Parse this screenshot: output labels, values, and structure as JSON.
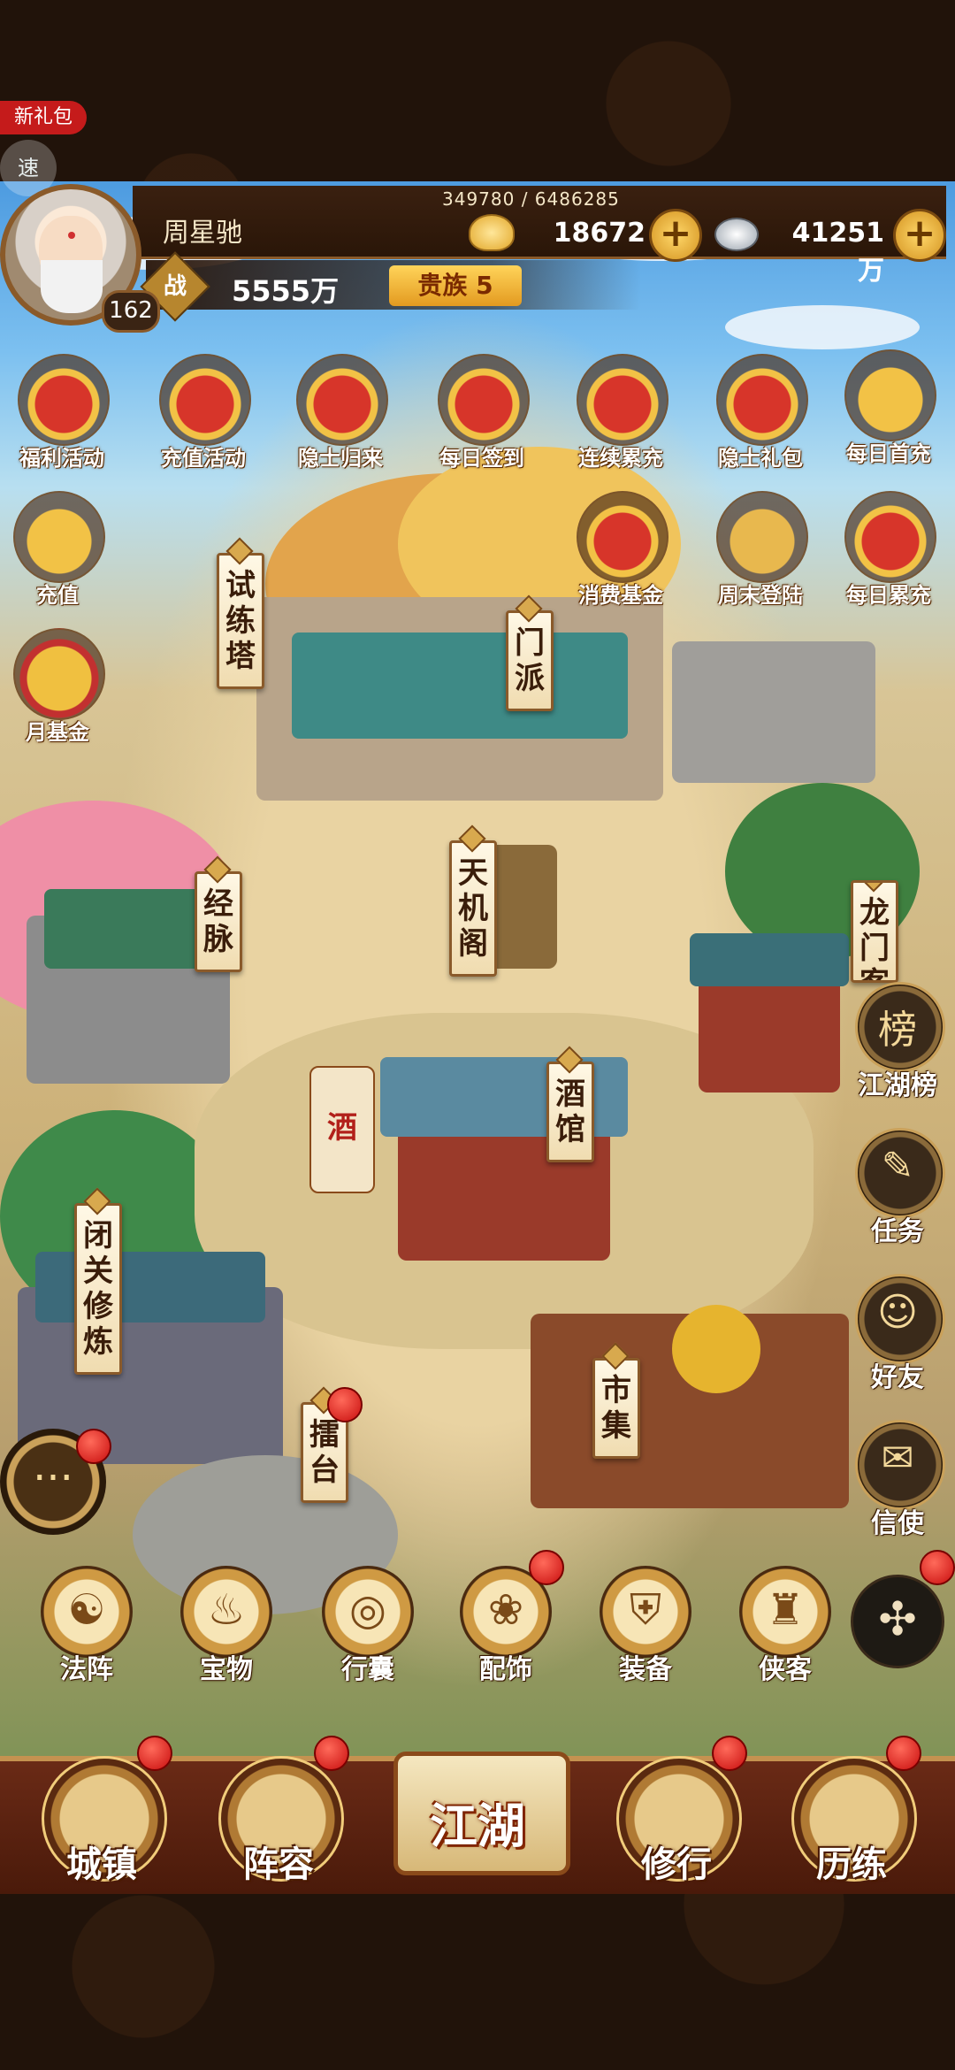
{
  "corner": {
    "gift_pack": "新礼包",
    "speed": "速"
  },
  "player": {
    "name": "周星驰",
    "level": "162",
    "xp": "349780 / 6486285",
    "gold": "18672",
    "silver": "41251万",
    "power_label": "战",
    "power": "5555万",
    "vip": "贵族 5"
  },
  "activities": [
    {
      "label": "福利活动",
      "icon": "gift-bag-icon"
    },
    {
      "label": "充值活动",
      "icon": "fan-icon"
    },
    {
      "label": "隐士归来",
      "icon": "fortune-bag-icon"
    },
    {
      "label": "每日签到",
      "icon": "fan-icon"
    },
    {
      "label": "连续累充",
      "icon": "red-bag-icon"
    },
    {
      "label": "隐士礼包",
      "icon": "fortune-bag-icon"
    },
    {
      "label": "每日首充",
      "icon": "gold-ingot-icon"
    },
    {
      "label": "充值",
      "icon": "gold-ingot-icon"
    },
    {
      "label": "消费基金",
      "icon": "gift-bag-icon"
    },
    {
      "label": "周末登陆",
      "icon": "horn-icon"
    },
    {
      "label": "每日累充",
      "icon": "red-bag-icon"
    },
    {
      "label": "月基金",
      "icon": "scroll-icon"
    }
  ],
  "map_labels": [
    "试练塔",
    "门派",
    "经脉",
    "天机阁",
    "龙门客",
    "酒馆",
    "闭关修炼",
    "擂台",
    "市集"
  ],
  "tavern_flag": "酒",
  "right_menu": [
    {
      "label": "江湖榜",
      "glyph": "榜"
    },
    {
      "label": "任务",
      "glyph": "✎"
    },
    {
      "label": "好友",
      "glyph": "☺"
    },
    {
      "label": "信使",
      "glyph": "✉"
    }
  ],
  "chat_glyph": "···",
  "functions": [
    {
      "label": "法阵",
      "glyph": "☯"
    },
    {
      "label": "宝物",
      "glyph": "♨"
    },
    {
      "label": "行囊",
      "glyph": "◎"
    },
    {
      "label": "配饰",
      "glyph": "❀"
    },
    {
      "label": "装备",
      "glyph": "⛨"
    },
    {
      "label": "侠客",
      "glyph": "♜"
    }
  ],
  "more_glyph": "✣",
  "nav": {
    "town": "城镇",
    "lineup": "阵容",
    "jianghu": "江湖",
    "practice": "修行",
    "training": "历练"
  }
}
